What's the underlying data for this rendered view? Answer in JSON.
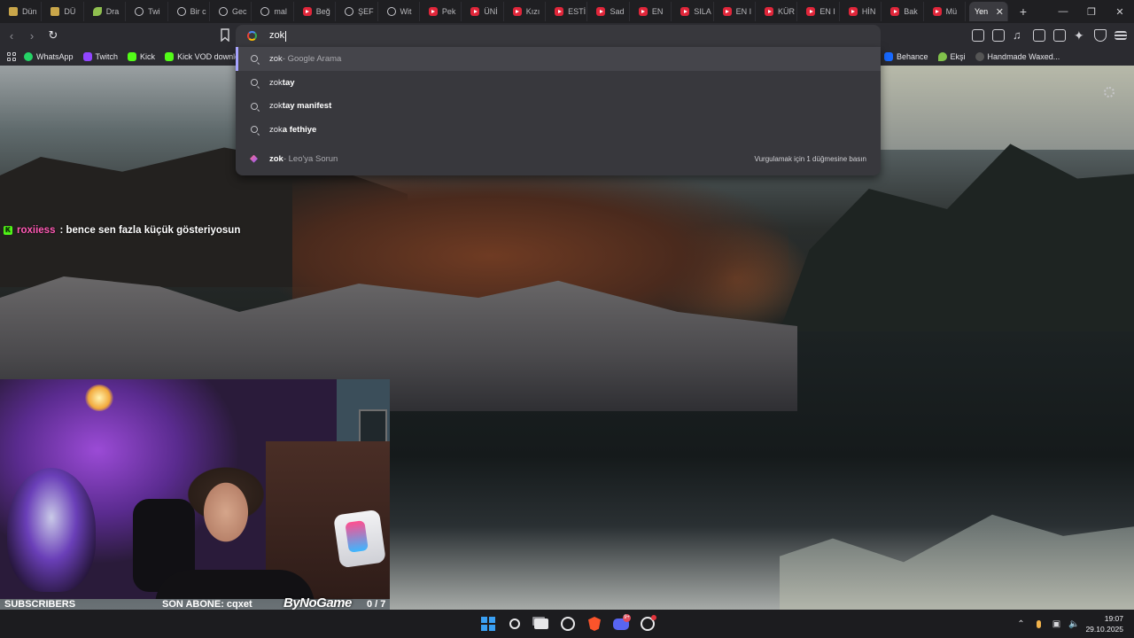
{
  "tabs": [
    {
      "label": "Dün",
      "icon": "doc-icon"
    },
    {
      "label": "DÜ",
      "icon": "doc-icon"
    },
    {
      "label": "Dra",
      "icon": "leaf-icon"
    },
    {
      "label": "Twi",
      "icon": "globe-icon"
    },
    {
      "label": "Bir c",
      "icon": "globe-icon"
    },
    {
      "label": "Gec",
      "icon": "globe-icon"
    },
    {
      "label": "mal",
      "icon": "globe-icon"
    },
    {
      "label": "Beğ",
      "icon": "youtube-icon"
    },
    {
      "label": "ŞEF",
      "icon": "globe-icon"
    },
    {
      "label": "Wit",
      "icon": "globe-icon"
    },
    {
      "label": "Pek",
      "icon": "youtube-icon"
    },
    {
      "label": "ÜNİ",
      "icon": "youtube-icon"
    },
    {
      "label": "Kızı",
      "icon": "youtube-icon"
    },
    {
      "label": "ESTİ",
      "icon": "youtube-icon"
    },
    {
      "label": "Sad",
      "icon": "youtube-icon"
    },
    {
      "label": "EN",
      "icon": "youtube-icon"
    },
    {
      "label": "SILA",
      "icon": "youtube-icon"
    },
    {
      "label": "EN I",
      "icon": "youtube-icon"
    },
    {
      "label": "KÜR",
      "icon": "youtube-icon"
    },
    {
      "label": "EN I",
      "icon": "youtube-icon"
    },
    {
      "label": "HİN",
      "icon": "youtube-icon"
    },
    {
      "label": "Bak",
      "icon": "youtube-icon"
    },
    {
      "label": "Mü",
      "icon": "youtube-icon"
    }
  ],
  "active_tab": {
    "label": "Yen",
    "close": "✕"
  },
  "window_controls": {
    "minimize": "—",
    "restore": "❐",
    "close": "✕"
  },
  "omnibox": {
    "value": "zok"
  },
  "bookmarks_left": [
    {
      "label": "WhatsApp",
      "icon": "wa"
    },
    {
      "label": "Twitch",
      "icon": "tw"
    },
    {
      "label": "Kick",
      "icon": "kick"
    },
    {
      "label": "Kick VOD downlo",
      "icon": "kick"
    }
  ],
  "bookmarks_right": [
    {
      "label": "Behance",
      "icon": "be"
    },
    {
      "label": "Ekşi",
      "icon": "eksi"
    },
    {
      "label": "Handmade Waxed...",
      "icon": "hw"
    }
  ],
  "suggestions": [
    {
      "typed": "zok",
      "completion": "",
      "suffix": " - Google Arama",
      "icon": "search"
    },
    {
      "typed": "zok",
      "completion": "tay",
      "suffix": "",
      "icon": "search"
    },
    {
      "typed": "zok",
      "completion": "tay manifest",
      "suffix": "",
      "icon": "search"
    },
    {
      "typed": "zok",
      "completion": "a fethiye",
      "suffix": "",
      "icon": "search"
    }
  ],
  "leo_suggestion": {
    "typed": "zok",
    "suffix": " - Leo'ya Sorun",
    "hint": "Vurgulamak için 1 düğmesine basın"
  },
  "chat": {
    "badge": "K",
    "username": "roxiiess",
    "message": ": bence sen fazla küçük gösteriyosun"
  },
  "overlay": {
    "subscribers_label": "SUBSCRIBERS",
    "last_sub": "SON ABONE: cqxet",
    "brand": "ByNoGame",
    "goal_count": "0  / 7",
    "goal_progress": 0.0
  },
  "taskbar": {
    "discord_badge": "9+",
    "time": "19:07",
    "date": "29.10.2025"
  },
  "colors": {
    "accent": "#a7a4ff",
    "kick": "#53fc18",
    "youtube": "#e0263a"
  }
}
